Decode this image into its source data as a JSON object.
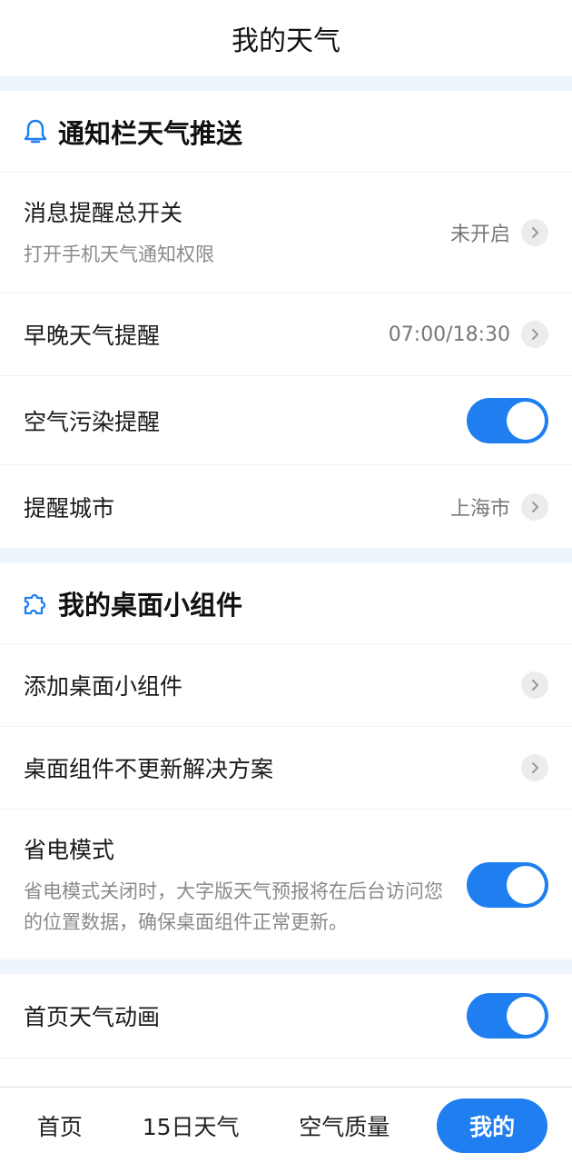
{
  "header": {
    "title": "我的天气"
  },
  "notify": {
    "title": "通知栏天气推送",
    "rows": [
      {
        "title": "消息提醒总开关",
        "sub": "打开手机天气通知权限",
        "value": "未开启"
      },
      {
        "title": "早晚天气提醒",
        "value": "07:00/18:30"
      },
      {
        "title": "空气污染提醒",
        "toggle": true
      },
      {
        "title": "提醒城市",
        "value": "上海市"
      }
    ]
  },
  "widget": {
    "title": "我的桌面小组件",
    "rows": [
      {
        "title": "添加桌面小组件"
      },
      {
        "title": "桌面组件不更新解决方案"
      },
      {
        "title": "省电模式",
        "sub": "省电模式关闭时，大字版天气预报将在后台访问您的位置数据，确保桌面组件正常更新。",
        "toggle": true
      }
    ]
  },
  "other": {
    "rows": [
      {
        "title": "首页天气动画",
        "toggle": true
      }
    ]
  },
  "tabbar": {
    "tabs": [
      {
        "label": "首页"
      },
      {
        "label": "15日天气"
      },
      {
        "label": "空气质量"
      },
      {
        "label": "我的",
        "active": true
      }
    ]
  },
  "colors": {
    "accent": "#1f7ef0",
    "section_bg": "#eef4fb"
  },
  "icons": {
    "notify": "bell-icon",
    "widget": "puzzle-icon",
    "chevron": "chevron-right-icon"
  }
}
